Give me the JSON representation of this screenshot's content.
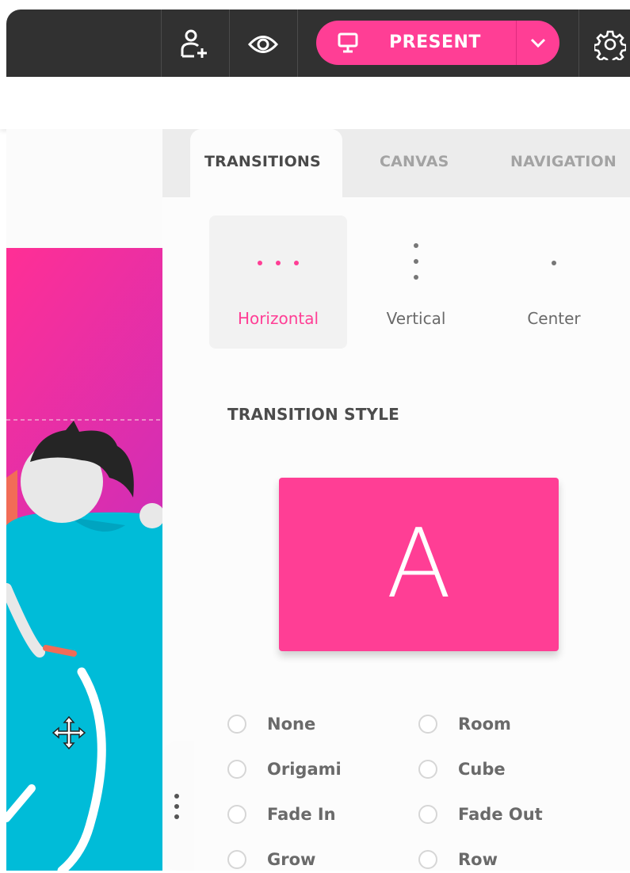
{
  "colors": {
    "accent": "#ff3e95",
    "topbar": "#313131",
    "canvas_cyan": "#00bcd8"
  },
  "topbar": {
    "add_user_icon": "add-user-icon",
    "preview_icon": "eye-icon",
    "present_label": "PRESENT",
    "settings_icon": "gear-icon"
  },
  "panel": {
    "tabs": [
      {
        "label": "TRANSITIONS",
        "active": true
      },
      {
        "label": "CANVAS",
        "active": false
      },
      {
        "label": "NAVIGATION",
        "active": false
      }
    ],
    "directions": [
      {
        "label": "Horizontal",
        "selected": true
      },
      {
        "label": "Vertical",
        "selected": false
      },
      {
        "label": "Center",
        "selected": false
      }
    ],
    "section_title": "TRANSITION STYLE",
    "preview_letter": "A",
    "styles": [
      {
        "label": "None"
      },
      {
        "label": "Room"
      },
      {
        "label": "Origami"
      },
      {
        "label": "Cube"
      },
      {
        "label": "Fade In"
      },
      {
        "label": "Fade Out"
      },
      {
        "label": "Grow"
      },
      {
        "label": "Row"
      }
    ]
  }
}
